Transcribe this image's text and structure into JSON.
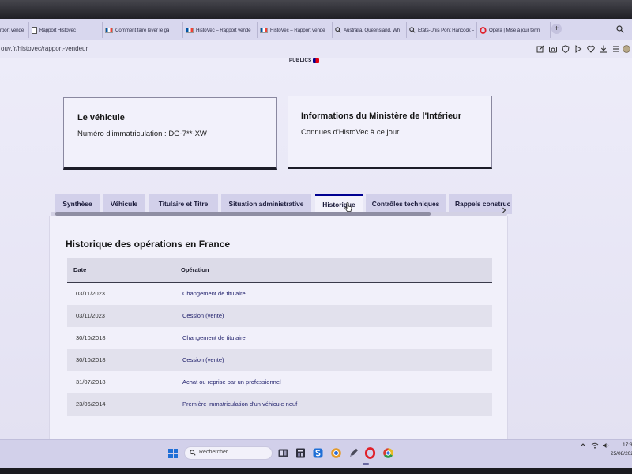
{
  "browser": {
    "tabs": [
      {
        "label": "rport vende",
        "icon": "none"
      },
      {
        "label": "Rapport Histovec",
        "icon": "document-icon"
      },
      {
        "label": "Comment faire lever le ga",
        "icon": "flag-icon"
      },
      {
        "label": "HistoVec – Rapport vende",
        "icon": "flag-icon"
      },
      {
        "label": "HistoVec – Rapport vende",
        "icon": "flag-icon"
      },
      {
        "label": "Australia, Queensland, Wh",
        "icon": "search-icon"
      },
      {
        "label": "États-Unis Pont Hancock –",
        "icon": "search-icon"
      },
      {
        "label": "Opera | Mise à jour termi",
        "icon": "opera-icon"
      }
    ],
    "new_tab": "+",
    "tabbar_icon": "search-icon",
    "address": "ouv.fr/histovec/rapport-vendeur",
    "toolbar_icons": [
      "edit-icon",
      "camera-icon",
      "shield-icon",
      "play-icon",
      "heart-icon",
      "download-icon",
      "menu-icon",
      "profile-icon"
    ]
  },
  "page": {
    "logo_text": "PUBLICS",
    "vehicle_card": {
      "title": "Le véhicule",
      "subtitle": "Numéro d'immatriculation : DG-7**-XW"
    },
    "ministry_card": {
      "title": "Informations du Ministère de l'Intérieur",
      "subtitle": "Connues d'HistoVec à ce jour"
    },
    "nav_tabs": [
      {
        "label": "Synthèse",
        "active": false
      },
      {
        "label": "Véhicule",
        "active": false
      },
      {
        "label": "Titulaire et Titre",
        "active": false
      },
      {
        "label": "Situation administrative",
        "active": false
      },
      {
        "label": "Historique",
        "active": true
      },
      {
        "label": "Contrôles techniques",
        "active": false
      },
      {
        "label": "Rappels construc",
        "active": false
      }
    ],
    "history": {
      "title": "Historique des opérations en France",
      "columns": [
        "Date",
        "Opération"
      ],
      "rows": [
        {
          "date": "03/11/2023",
          "operation": "Changement de titulaire"
        },
        {
          "date": "03/11/2023",
          "operation": "Cession (vente)"
        },
        {
          "date": "30/10/2018",
          "operation": "Changement de titulaire"
        },
        {
          "date": "30/10/2018",
          "operation": "Cession (vente)"
        },
        {
          "date": "31/07/2018",
          "operation": "Achat ou reprise par un professionnel"
        },
        {
          "date": "23/06/2014",
          "operation": "Première immatriculation d'un véhicule neuf"
        }
      ]
    }
  },
  "taskbar": {
    "start_icon": "windows-icon",
    "search_placeholder": "Rechercher",
    "apps": [
      "task-view-icon",
      "widgets-icon",
      "skype-icon",
      "browser-icon",
      "pen-app-icon",
      "opera-icon",
      "chrome-icon"
    ],
    "tray_icons": [
      "chevron-up-icon",
      "wifi-icon",
      "volume-icon"
    ],
    "time": "17:3",
    "date": "25/08/202"
  },
  "colors": {
    "accent": "#000091",
    "page_bg": "#e9e7f6",
    "taskbar_bg": "#d2d0ea",
    "active_tab_bg": "#f3f2fb",
    "opera_red": "#e0202a"
  }
}
